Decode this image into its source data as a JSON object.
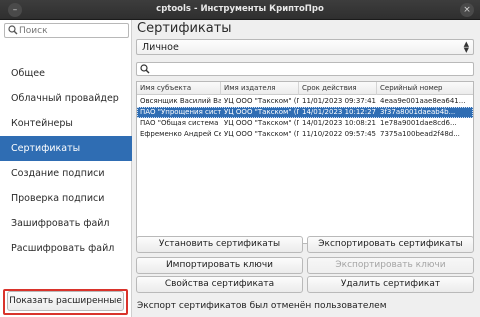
{
  "window": {
    "title": "cptools - Инструменты КриптоПро",
    "minimize_glyph": "–",
    "close_glyph": "×"
  },
  "sidebar": {
    "search_placeholder": "Поиск",
    "items": [
      {
        "label": "Общее"
      },
      {
        "label": "Облачный провайдер"
      },
      {
        "label": "Контейнеры"
      },
      {
        "label": "Сертификаты",
        "active": true
      },
      {
        "label": "Создание подписи"
      },
      {
        "label": "Проверка подписи"
      },
      {
        "label": "Зашифровать файл"
      },
      {
        "label": "Расшифровать файл"
      }
    ],
    "show_extended_label": "Показать расширенные"
  },
  "main": {
    "title": "Сертификаты",
    "store_select": {
      "value": "Личное"
    },
    "search_value": "",
    "table": {
      "columns": [
        "Имя субъекта",
        "Имя издателя",
        "Срок действия",
        "Серийный номер"
      ],
      "rows": [
        {
          "subject": "Овсянщик Василий Вас...",
          "issuer": "УЦ ООО \"Такском\" (ГО...",
          "expires": "11/01/2023 09:37:41",
          "serial": "4eaa9e001aae8ea641...",
          "selected": false
        },
        {
          "subject": "ПАО \"Упрощения сист...",
          "issuer": "УЦ ООО \"Такском\" (ГО...",
          "expires": "14/01/2023 10:12:27",
          "serial": "3f37a8001daeab4b...",
          "selected": true
        },
        {
          "subject": "ПАО \"Общая система на...",
          "issuer": "УЦ ООО \"Такском\" (ГО...",
          "expires": "14/01/2023 10:08:21",
          "serial": "1e78a9001dae8cd6...",
          "selected": false
        },
        {
          "subject": "Ефременко Андрей Сер...",
          "issuer": "УЦ ООО \"Такском\" (ГО...",
          "expires": "11/10/2022 09:57:45",
          "serial": "7375a100bead2f48d...",
          "selected": false
        }
      ]
    },
    "buttons": {
      "install": "Установить сертификаты",
      "export": "Экспортировать сертификаты",
      "import_keys": "Импортировать ключи",
      "export_keys": "Экспортировать ключи",
      "properties": "Свойства сертификата",
      "delete": "Удалить сертификат"
    },
    "status_text": "Экспорт сертификатов был отменён пользователем"
  },
  "colors": {
    "accent": "#2f6db3",
    "highlight": "#d9332b"
  },
  "icons": [
    "search-icon",
    "chevron-updown-icon",
    "minimize-icon",
    "close-icon"
  ]
}
